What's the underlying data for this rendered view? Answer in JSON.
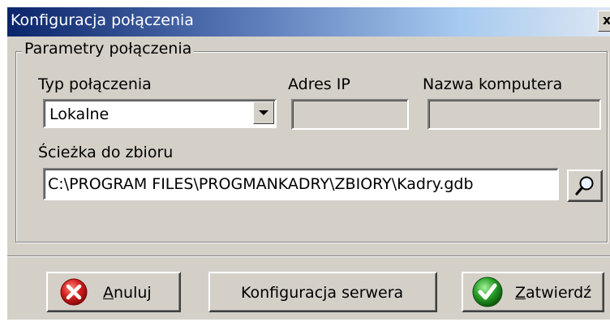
{
  "window": {
    "title": "Konfiguracja połączenia",
    "close_label": "x"
  },
  "group": {
    "legend": "Parametry połączenia"
  },
  "connection_type": {
    "label": "Typ połączenia",
    "value": "Lokalne"
  },
  "ip_address": {
    "label": "Adres IP",
    "value": ""
  },
  "computer_name": {
    "label": "Nazwa komputera",
    "value": ""
  },
  "path": {
    "label": "Ścieżka do zbioru",
    "value": "C:\\PROGRAM FILES\\PROGMANKADRY\\ZBIORY\\Kadry.gdb"
  },
  "buttons": {
    "cancel_mnemonic": "A",
    "cancel_rest": "nuluj",
    "server": "Konfiguracja serwera",
    "ok_mnemonic": "Z",
    "ok_rest": "atwierdź"
  },
  "icons": {
    "browse": "magnifier-icon",
    "cancel": "red-x-circle-icon",
    "ok": "green-check-circle-icon"
  },
  "colors": {
    "title_start": "#0a246a",
    "title_end": "#dce6f2",
    "dialog_bg": "#d4d0c8",
    "cancel_icon": "#d42020",
    "ok_icon": "#2aa02a"
  }
}
